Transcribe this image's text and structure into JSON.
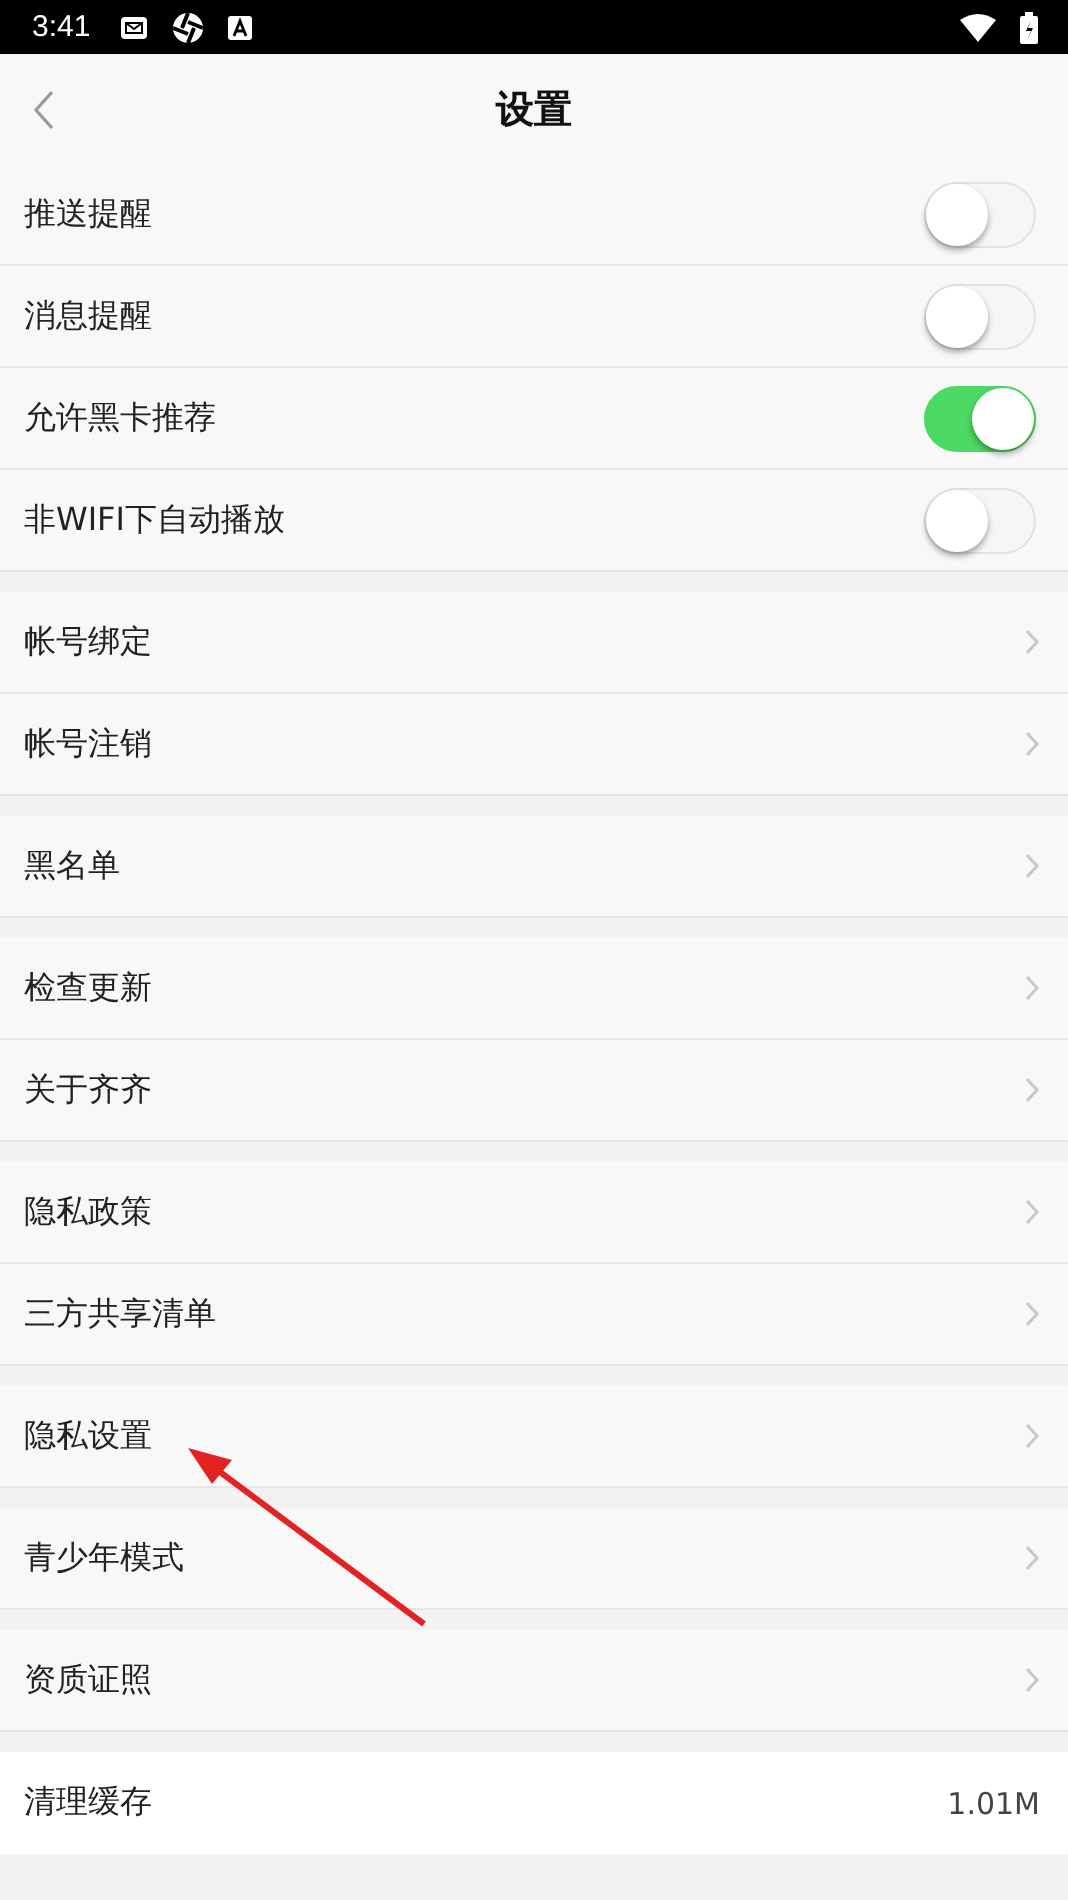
{
  "status_bar": {
    "time": "3:41"
  },
  "header": {
    "title": "设置"
  },
  "groups": [
    {
      "items": [
        {
          "kind": "toggle",
          "label": "推送提醒",
          "on": false
        },
        {
          "kind": "toggle",
          "label": "消息提醒",
          "on": false
        },
        {
          "kind": "toggle",
          "label": "允许黑卡推荐",
          "on": true
        },
        {
          "kind": "toggle",
          "label": "非WIFI下自动播放",
          "on": false
        }
      ]
    },
    {
      "items": [
        {
          "kind": "link",
          "label": "帐号绑定"
        },
        {
          "kind": "link",
          "label": "帐号注销"
        }
      ]
    },
    {
      "items": [
        {
          "kind": "link",
          "label": "黑名单"
        }
      ]
    },
    {
      "items": [
        {
          "kind": "link",
          "label": "检查更新"
        },
        {
          "kind": "link",
          "label": "关于齐齐"
        }
      ]
    },
    {
      "items": [
        {
          "kind": "link",
          "label": "隐私政策"
        },
        {
          "kind": "link",
          "label": "三方共享清单"
        }
      ]
    },
    {
      "items": [
        {
          "kind": "link",
          "label": "隐私设置"
        }
      ]
    },
    {
      "items": [
        {
          "kind": "link",
          "label": "青少年模式"
        }
      ]
    },
    {
      "items": [
        {
          "kind": "link",
          "label": "资质证照"
        }
      ]
    },
    {
      "items": [
        {
          "kind": "value",
          "label": "清理缓存",
          "value": "1.01M"
        }
      ]
    }
  ],
  "annotations": [
    {
      "kind": "arrow",
      "color": "#e32222"
    }
  ]
}
